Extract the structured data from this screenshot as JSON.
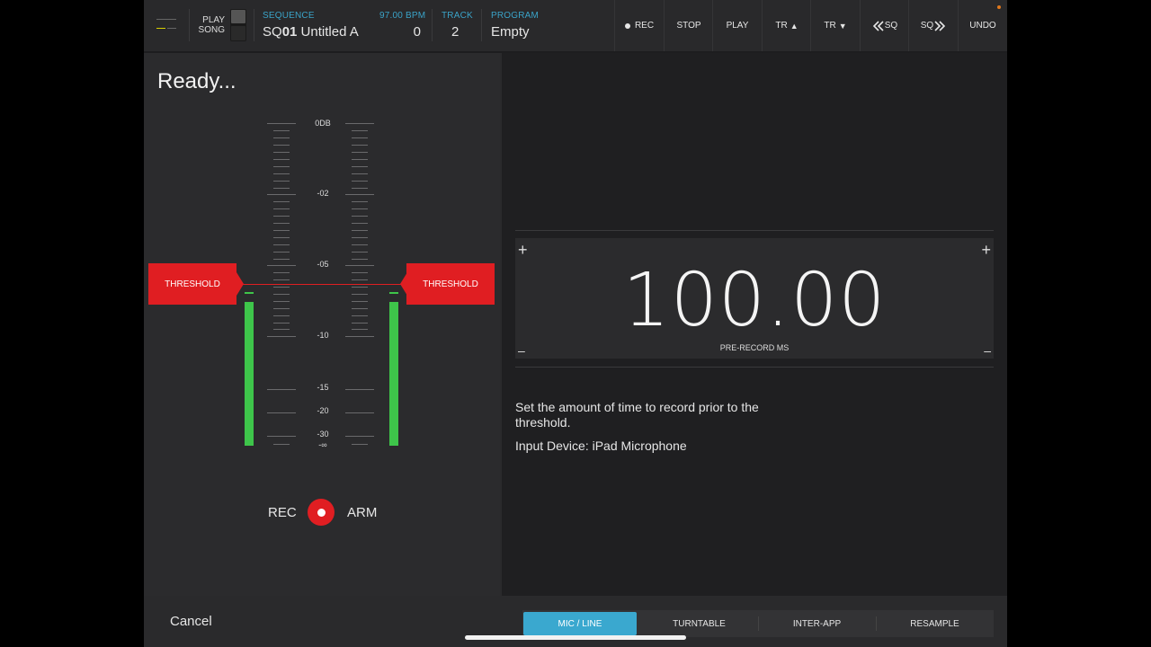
{
  "topbar": {
    "play_song_line1": "PLAY",
    "play_song_line2": "SONG",
    "sequence_label": "SEQUENCE",
    "sequence_prefix": "SQ",
    "sequence_number": "01",
    "sequence_name": "Untitled A",
    "bpm_label": "97.00 BPM",
    "bar_value": "0",
    "track_label": "TRACK",
    "track_value": "2",
    "program_label": "PROGRAM",
    "program_value": "Empty",
    "buttons": {
      "rec": "REC",
      "stop": "STOP",
      "play": "PLAY",
      "track_up": "TR",
      "track_down": "TR",
      "seq_prev": "SQ",
      "seq_next": "SQ",
      "undo": "UNDO"
    }
  },
  "left_panel": {
    "status": "Ready...",
    "db_labels": [
      "0DB",
      "-02",
      "-05",
      "-10",
      "-15",
      "-20",
      "-30",
      "-∞"
    ],
    "threshold_left": "THRESHOLD",
    "threshold_right": "THRESHOLD",
    "meter_left_level": 0.64,
    "meter_right_level": 0.64,
    "rec_label": "REC",
    "arm_label": "ARM"
  },
  "right_panel": {
    "value": "100.00",
    "value_caption": "PRE-RECORD MS",
    "plus_glyph": "+",
    "minus_glyph": "–",
    "description": "Set the amount of time to record prior to the threshold.",
    "input_device": "Input Device: iPad Microphone"
  },
  "bottom": {
    "cancel": "Cancel",
    "sources": [
      "MIC / LINE",
      "TURNTABLE",
      "INTER-APP",
      "RESAMPLE"
    ],
    "active_source": "MIC / LINE"
  },
  "colors": {
    "accent": "#3aa8cf",
    "record_red": "#e01e22",
    "meter_green": "#3ec54a",
    "indicator_orange": "#e0781c"
  }
}
